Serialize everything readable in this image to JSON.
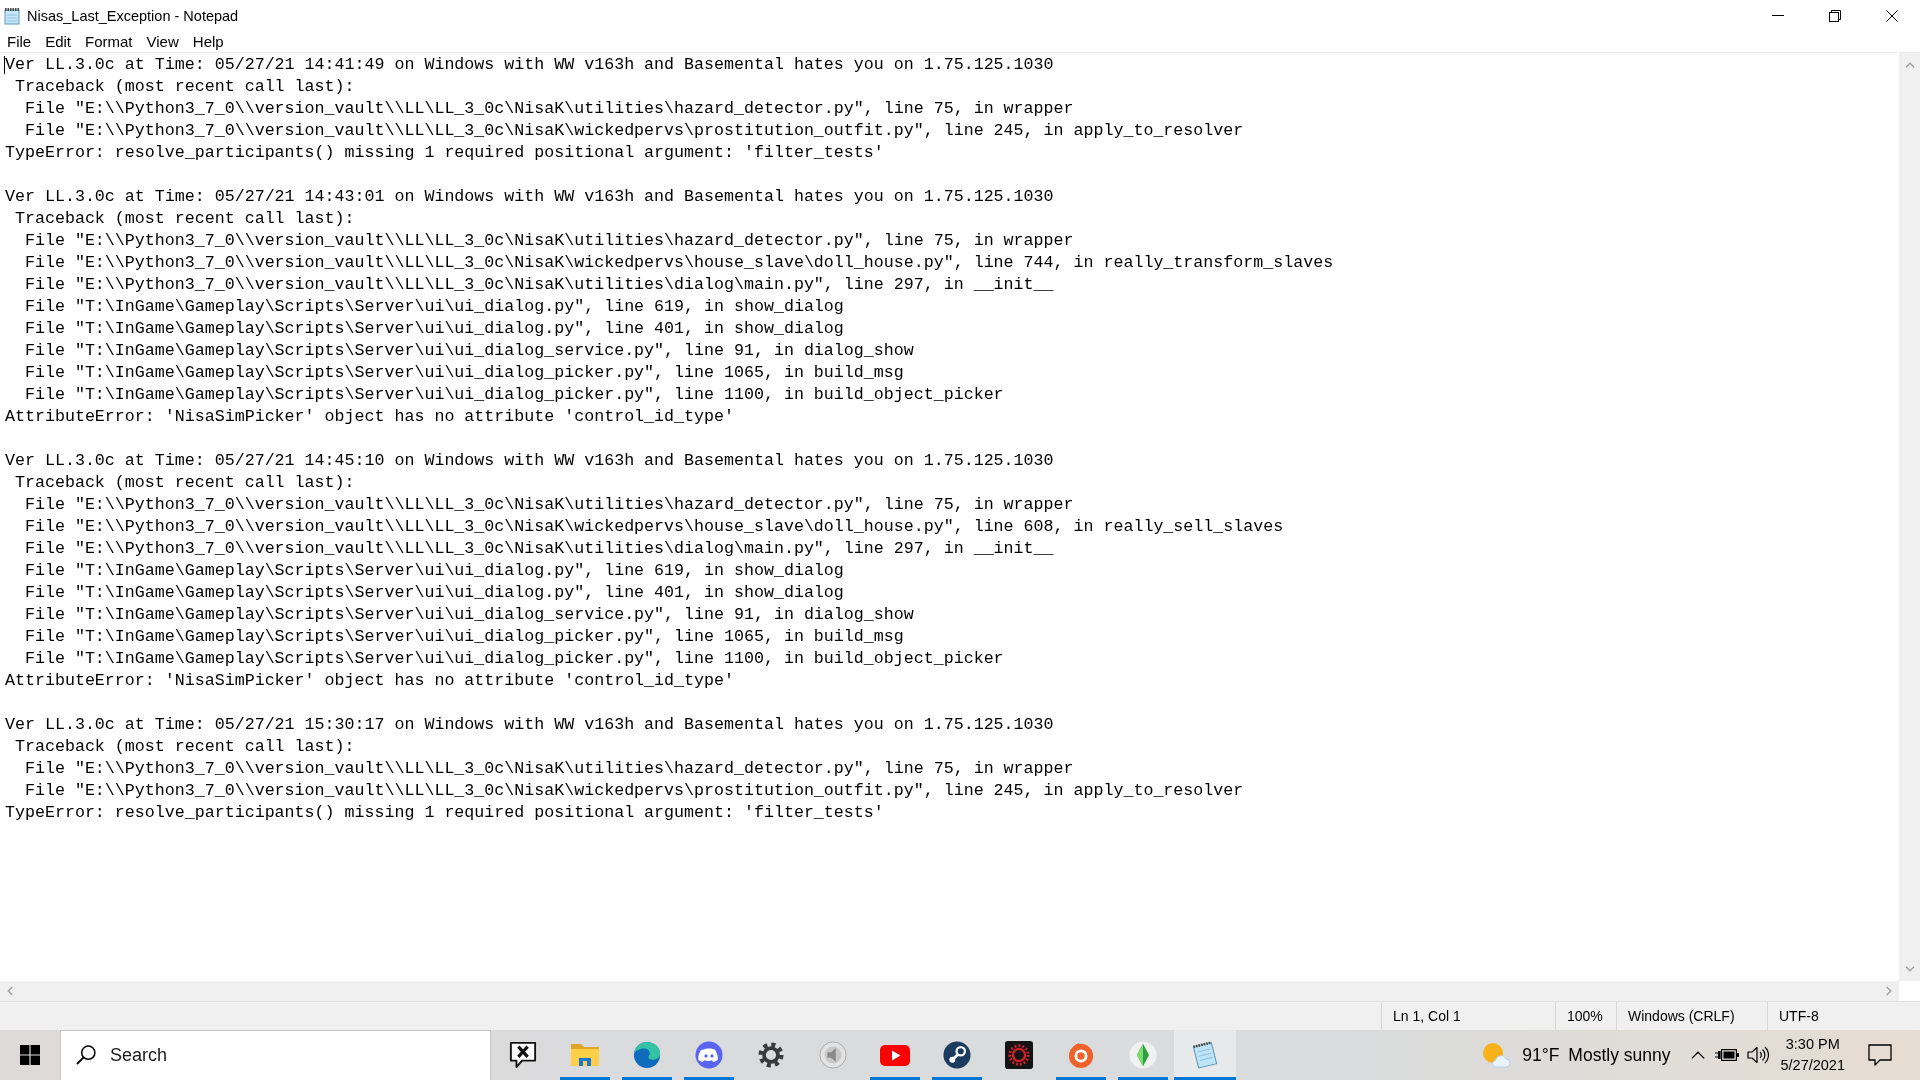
{
  "window": {
    "title": "Nisas_Last_Exception - Notepad"
  },
  "menu": [
    "File",
    "Edit",
    "Format",
    "View",
    "Help"
  ],
  "editor": {
    "entries": [
      {
        "header": "Ver LL.3.0c at Time: 05/27/21 14:41:49 on Windows with WW v163h and Basemental hates you on 1.75.125.1030",
        "traceback": "Traceback (most recent call last):",
        "frames": [
          "File \"E:\\\\Python3_7_0\\\\version_vault\\\\LL\\LL_3_0c\\NisaK\\utilities\\hazard_detector.py\", line 75, in wrapper",
          "File \"E:\\\\Python3_7_0\\\\version_vault\\\\LL\\LL_3_0c\\NisaK\\wickedpervs\\prostitution_outfit.py\", line 245, in apply_to_resolver"
        ],
        "error": "TypeError: resolve_participants() missing 1 required positional argument: 'filter_tests'"
      },
      {
        "header": "Ver LL.3.0c at Time: 05/27/21 14:43:01 on Windows with WW v163h and Basemental hates you on 1.75.125.1030",
        "traceback": "Traceback (most recent call last):",
        "frames": [
          "File \"E:\\\\Python3_7_0\\\\version_vault\\\\LL\\LL_3_0c\\NisaK\\utilities\\hazard_detector.py\", line 75, in wrapper",
          "File \"E:\\\\Python3_7_0\\\\version_vault\\\\LL\\LL_3_0c\\NisaK\\wickedpervs\\house_slave\\doll_house.py\", line 744, in really_transform_slaves",
          "File \"E:\\\\Python3_7_0\\\\version_vault\\\\LL\\LL_3_0c\\NisaK\\utilities\\dialog\\main.py\", line 297, in __init__",
          "File \"T:\\InGame\\Gameplay\\Scripts\\Server\\ui\\ui_dialog.py\", line 619, in show_dialog",
          "File \"T:\\InGame\\Gameplay\\Scripts\\Server\\ui\\ui_dialog.py\", line 401, in show_dialog",
          "File \"T:\\InGame\\Gameplay\\Scripts\\Server\\ui\\ui_dialog_service.py\", line 91, in dialog_show",
          "File \"T:\\InGame\\Gameplay\\Scripts\\Server\\ui\\ui_dialog_picker.py\", line 1065, in build_msg",
          "File \"T:\\InGame\\Gameplay\\Scripts\\Server\\ui\\ui_dialog_picker.py\", line 1100, in build_object_picker"
        ],
        "error": "AttributeError: 'NisaSimPicker' object has no attribute 'control_id_type'"
      },
      {
        "header": "Ver LL.3.0c at Time: 05/27/21 14:45:10 on Windows with WW v163h and Basemental hates you on 1.75.125.1030",
        "traceback": "Traceback (most recent call last):",
        "frames": [
          "File \"E:\\\\Python3_7_0\\\\version_vault\\\\LL\\LL_3_0c\\NisaK\\utilities\\hazard_detector.py\", line 75, in wrapper",
          "File \"E:\\\\Python3_7_0\\\\version_vault\\\\LL\\LL_3_0c\\NisaK\\wickedpervs\\house_slave\\doll_house.py\", line 608, in really_sell_slaves",
          "File \"E:\\\\Python3_7_0\\\\version_vault\\\\LL\\LL_3_0c\\NisaK\\utilities\\dialog\\main.py\", line 297, in __init__",
          "File \"T:\\InGame\\Gameplay\\Scripts\\Server\\ui\\ui_dialog.py\", line 619, in show_dialog",
          "File \"T:\\InGame\\Gameplay\\Scripts\\Server\\ui\\ui_dialog.py\", line 401, in show_dialog",
          "File \"T:\\InGame\\Gameplay\\Scripts\\Server\\ui\\ui_dialog_service.py\", line 91, in dialog_show",
          "File \"T:\\InGame\\Gameplay\\Scripts\\Server\\ui\\ui_dialog_picker.py\", line 1065, in build_msg",
          "File \"T:\\InGame\\Gameplay\\Scripts\\Server\\ui\\ui_dialog_picker.py\", line 1100, in build_object_picker"
        ],
        "error": "AttributeError: 'NisaSimPicker' object has no attribute 'control_id_type'"
      },
      {
        "header": "Ver LL.3.0c at Time: 05/27/21 15:30:17 on Windows with WW v163h and Basemental hates you on 1.75.125.1030",
        "traceback": "Traceback (most recent call last):",
        "frames": [
          "File \"E:\\\\Python3_7_0\\\\version_vault\\\\LL\\LL_3_0c\\NisaK\\utilities\\hazard_detector.py\", line 75, in wrapper",
          "File \"E:\\\\Python3_7_0\\\\version_vault\\\\LL\\LL_3_0c\\NisaK\\wickedpervs\\prostitution_outfit.py\", line 245, in apply_to_resolver"
        ],
        "error": "TypeError: resolve_participants() missing 1 required positional argument: 'filter_tests'"
      }
    ]
  },
  "status_bar": {
    "position": "Ln 1, Col 1",
    "zoom": "100%",
    "line_ending": "Windows (CRLF)",
    "encoding": "UTF-8"
  },
  "taskbar": {
    "search": {
      "placeholder": "Search"
    },
    "apps": [
      {
        "kind": "bubble",
        "running": false,
        "selected": false
      },
      {
        "kind": "folder",
        "running": true,
        "selected": false
      },
      {
        "kind": "swirl",
        "running": true,
        "selected": false
      },
      {
        "kind": "controller",
        "running": true,
        "selected": false
      },
      {
        "kind": "gear",
        "running": false,
        "selected": false
      },
      {
        "kind": "speaker",
        "running": false,
        "selected": false
      },
      {
        "kind": "play",
        "running": true,
        "selected": false
      },
      {
        "kind": "lever",
        "running": true,
        "selected": false
      },
      {
        "kind": "emblem",
        "running": false,
        "selected": false
      },
      {
        "kind": "ring",
        "running": true,
        "selected": false
      },
      {
        "kind": "diamond",
        "running": true,
        "selected": false
      },
      {
        "kind": "notepad",
        "running": true,
        "selected": true
      }
    ],
    "weather": {
      "temperature": "91°F",
      "condition": "Mostly sunny"
    },
    "clock": {
      "time": "3:30 PM",
      "date": "5/27/2021"
    }
  }
}
